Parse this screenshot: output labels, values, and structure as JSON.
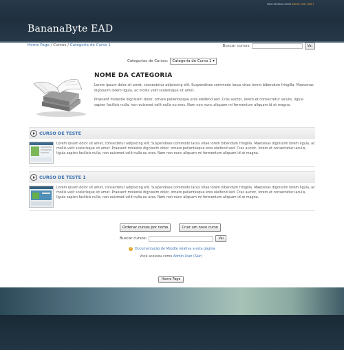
{
  "header": {
    "login_text": "Você acessou como",
    "login_user": "Admin User",
    "login_sair": "(Sair)",
    "logo": "BananaByte EAD"
  },
  "breadcrumb": {
    "home": "Home Page",
    "cursos": "Cursos",
    "categoria": "Categoria de Curso 1"
  },
  "search_top": {
    "label": "Buscar cursos",
    "button": "Vai"
  },
  "category_select": {
    "label": "Categorias de Cursos:",
    "value": "Categoria de Curso 1"
  },
  "category": {
    "title": "NOME DA CATEGORIA",
    "p1": "Lorem ipsum dolor sit amet, consectetur adipiscing elit. Suspendisse commodo lacus vitae lorem bibendum fringilla. Maecenas dignissim lorem ligula, ac mollis velit scelerisque sit amet.",
    "p2": "Praesent molestie dignissim dolor, ornare pellentesque eros eleifend sed. Cras auctor, lorem et consectetur iaculis, ligula sapien facilisis nulla, non euismod velit nulla eu eros. Nam non nunc aliquam mi fermentum aliquam id at magna."
  },
  "courses": [
    {
      "title": "CURSO DE TESTE",
      "summary": "Lorem ipsum dolor sit amet, consectetur adipiscing elit. Suspendisse commodo lacus vitae lorem bibendum fringilla. Maecenas dignissim lorem ligula, ac mollis velit scelerisque sit amet. Praesent molestie dignissim dolor, ornare pellentesque eros eleifend sed. Cras auctor, lorem et consectetur iaculis, ligula sapien facilisis nulla, non euismod velit nulla eu eros. Nam non nunc aliquam mi fermentum aliquam id at magna."
    },
    {
      "title": "CURSO DE TESTE 1",
      "summary": "Lorem ipsum dolor sit amet, consectetur adipiscing elit. Suspendisse commodo lacus vitae lorem bibendum fringilla. Maecenas dignissim lorem ligula, ac mollis velit scelerisque sit amet. Praesent molestie dignissim dolor, ornare pellentesque eros eleifend sed. Cras auctor, lorem et consectetur iaculis, ligula sapien facilisis nulla, non euismod velit nulla eu eros. Nam non nunc aliquam mi fermentum aliquam id at magna."
    }
  ],
  "actions": {
    "sort": "Ordenar cursos por nome",
    "create": "Criar um novo curso"
  },
  "bottom_search": {
    "label": "Buscar cursos:",
    "button": "Vai"
  },
  "doc_link": "Documentação de Moodle relativa a esta página",
  "logged_as": {
    "text": "Você acessou como",
    "user": "Admin User",
    "sair": "(Sair)"
  },
  "home_button": "Home Page",
  "colors": {
    "link": "#3d73b3",
    "header": "#1f2f3e",
    "accent": "#e5a73a"
  }
}
